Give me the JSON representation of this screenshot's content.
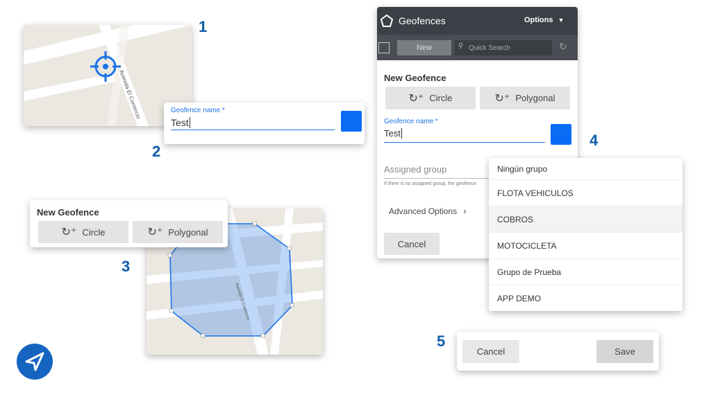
{
  "steps": [
    "1",
    "2",
    "3",
    "4",
    "5"
  ],
  "map1": {
    "street": "Avenida El Comercio"
  },
  "map3": {
    "street": "Avenida El Comercio"
  },
  "card2": {
    "label": "Geofence name *",
    "value": "Test",
    "color": "#0a6cf5"
  },
  "card3": {
    "title": "New Geofence",
    "circle": "Circle",
    "polygonal": "Polygonal"
  },
  "panel": {
    "title": "Geofences",
    "options": "Options",
    "new_label": "New",
    "search_placeholder": "Quick Search",
    "section_title": "New Geofence",
    "circle": "Circle",
    "polygonal": "Polygonal",
    "name_label": "Geofence name *",
    "name_value": "Test",
    "group_label": "Assigned group",
    "group_hint": "If there is no assigned group, the geofence",
    "advanced": "Advanced Options",
    "cancel": "Cancel",
    "header_color": "#3c4046"
  },
  "dropdown": {
    "items": [
      "Ningún grupo",
      "FLOTA VEHICULOS",
      "COBROS",
      "MOTOCICLETA",
      "Grupo de Prueba",
      "APP DEMO"
    ]
  },
  "footer": {
    "cancel": "Cancel",
    "save": "Save"
  },
  "polygon_color": "#1a73e8"
}
